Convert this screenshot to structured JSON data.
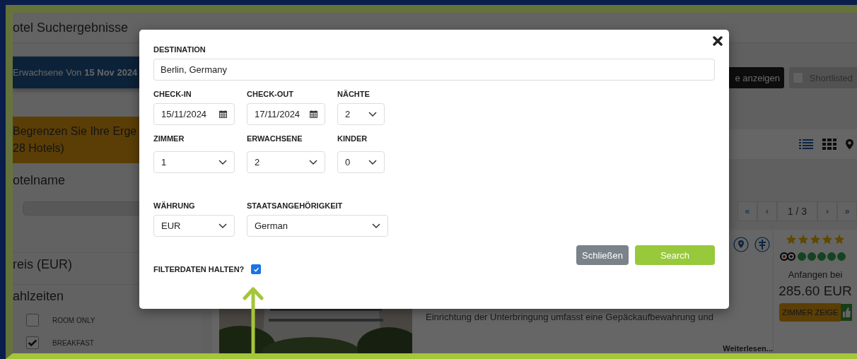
{
  "background": {
    "title": "otel Suchergebnisse",
    "summary": "Erwachsene Von **15 Nov 2024**",
    "show_button": "e anzeigen",
    "shortlisted": {
      "label": "Shortlisted",
      "checked": false
    },
    "filter_box": [
      "Begrenzen Sie Ihre Erge",
      "28 Hotels)"
    ],
    "sections": [
      "otelname",
      "reis (EUR)",
      "ahlzeiten"
    ],
    "meals": [
      {
        "label": "ROOM ONLY",
        "checked": false
      },
      {
        "label": "BREAKFAST",
        "checked": true
      }
    ],
    "views": [
      {
        "kind": "list",
        "selected": true
      },
      {
        "kind": "grid",
        "selected": false
      },
      {
        "kind": "map",
        "selected": false
      }
    ],
    "pagination": [
      "«",
      "‹",
      "1 / 3",
      "›",
      "»"
    ],
    "hotel": {
      "stars": 5,
      "price_label": "Anfangen bei",
      "price": "285.60 EUR",
      "rooms_button": "ZIMMER ZEIGE",
      "description": "Einrichtung der Unterbringung umfasst eine Gepäckaufbewahrung und",
      "read_more": "Weiterlesen..."
    }
  },
  "modal": {
    "destination": {
      "label": "DESTINATION",
      "value": "Berlin, Germany"
    },
    "rows": [
      [
        {
          "label": "CHECK-IN",
          "value": "15/11/2024",
          "kind": "date"
        },
        {
          "label": "CHECK-OUT",
          "value": "17/11/2024",
          "kind": "date"
        },
        {
          "label": "NÄCHTE",
          "value": "2",
          "kind": "select"
        }
      ],
      [
        {
          "label": "ZIMMER",
          "value": "1",
          "kind": "select"
        },
        {
          "label": "ERWACHSENE",
          "value": "2",
          "kind": "select"
        },
        {
          "label": "KINDER",
          "value": "0",
          "kind": "select"
        }
      ],
      [
        {
          "label": "WÄHRUNG",
          "value": "EUR",
          "kind": "select"
        },
        {
          "label": "STAATSANGEHÖRIGKEIT",
          "value": "German",
          "kind": "select"
        }
      ]
    ],
    "keep_filters": {
      "label": "FILTERDATEN HALTEN?",
      "checked": true
    },
    "close_button": "Schließen",
    "search_button": "Search"
  }
}
